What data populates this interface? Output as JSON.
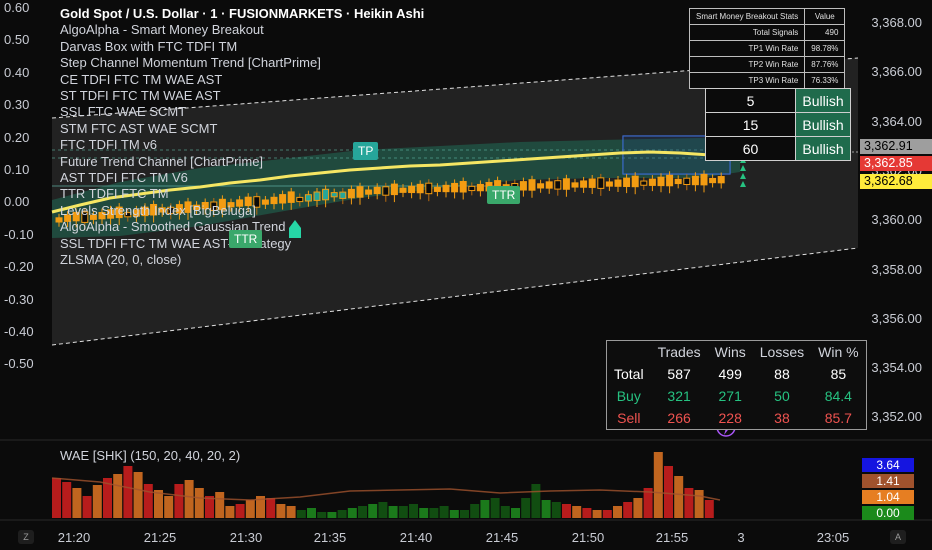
{
  "legend": {
    "title": "Gold Spot / U.S. Dollar · 1 · FUSIONMARKETS · Heikin Ashi",
    "indicators": [
      "AlgoAlpha - Smart Money Breakout",
      "Darvas Box with FTC TDFI TM",
      "Step Channel Momentum Trend [ChartPrime]",
      "CE TDFI FTC TM WAE AST",
      "ST TDFI FTC TM WAE AST",
      "SSL FTC WAE SCMT",
      "STM FTC AST WAE SCMT",
      "FTC TDFI TM v6",
      "Future Trend Channel [ChartPrime]",
      "AST TDFI FTC TM V6",
      "TTR TDFI FTC TM",
      "Levels Strength Index [BigBeluga]",
      "AlgoAlpha - Smoothed Gaussian Trend",
      "SSL TDFI FTC TM WAE AST— strategy",
      "ZLSMA (20, 0, close)"
    ]
  },
  "left_axis": [
    "0.60",
    "0.50",
    "0.40",
    "0.30",
    "0.20",
    "0.10",
    "0.00",
    "-0.10",
    "-0.20",
    "-0.30",
    "-0.40",
    "-0.50"
  ],
  "right_axis": [
    "3,368.00",
    "3,366.00",
    "3,364.00",
    "3,362.00",
    "3,360.00",
    "3,358.00",
    "3,356.00",
    "3,354.00",
    "3,352.00"
  ],
  "price_tags": [
    {
      "value": "3,362.91",
      "bg": "#9e9e9e",
      "fg": "#000000"
    },
    {
      "value": "3,362.85",
      "bg": "#e53935",
      "fg": "#ffffff"
    },
    {
      "value": "3,362.68",
      "bg": "#ffeb3b",
      "fg": "#000000"
    }
  ],
  "x_axis": [
    "21:20",
    "21:25",
    "21:30",
    "21:35",
    "21:40",
    "21:45",
    "21:50",
    "21:55",
    "3",
    "23:05"
  ],
  "stats_table": {
    "header": [
      "Smart Money Breakout Stats",
      "Value"
    ],
    "rows": [
      [
        "Total Signals",
        "490"
      ],
      [
        "TP1 Win Rate",
        "98.78%"
      ],
      [
        "TP2 Win Rate",
        "87.76%"
      ],
      [
        "TP3 Win Rate",
        "76.33%"
      ]
    ]
  },
  "trend_table": [
    {
      "n": "5",
      "state": "Bullish"
    },
    {
      "n": "15",
      "state": "Bullish"
    },
    {
      "n": "60",
      "state": "Bullish"
    }
  ],
  "perf_table": {
    "header": [
      "",
      "Trades",
      "Wins",
      "Losses",
      "Win %"
    ],
    "rows": [
      {
        "label": "Total",
        "cells": [
          "587",
          "499",
          "88",
          "85"
        ],
        "color": "#ffffff"
      },
      {
        "label": "Buy",
        "cells": [
          "321",
          "271",
          "50",
          "84.4"
        ],
        "color": "#26c281"
      },
      {
        "label": "Sell",
        "cells": [
          "266",
          "228",
          "38",
          "85.7"
        ],
        "color": "#ef5350"
      }
    ]
  },
  "signals": {
    "tp": "TP",
    "ttr1": "TTR",
    "ttr2": "TTR"
  },
  "wae": {
    "title": "WAE [SHK] (150, 20, 40, 20, 2)",
    "tags": [
      {
        "value": "3.64",
        "bg": "#1515e0"
      },
      {
        "value": "1.41",
        "bg": "#a0522d"
      },
      {
        "value": "1.04",
        "bg": "#e67e22"
      },
      {
        "value": "0.00",
        "bg": "#1b8a1b"
      }
    ]
  },
  "colors": {
    "bull": "#26a69a",
    "candle": "#f39c12",
    "zlsma": "#f5e663",
    "channel": "#2e8b6e",
    "bear": "#c62828"
  }
}
